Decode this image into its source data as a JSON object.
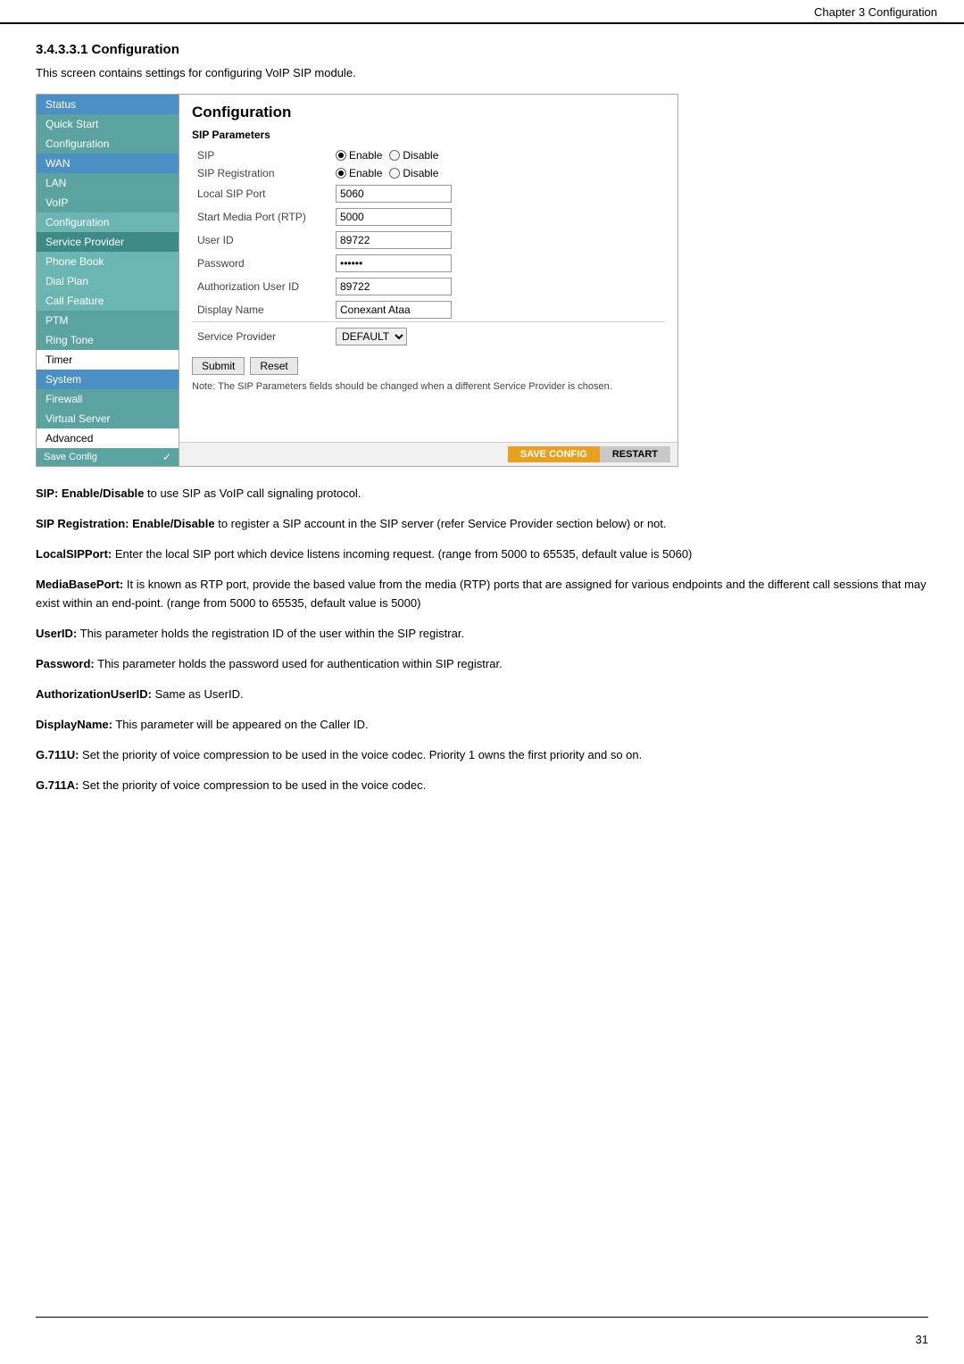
{
  "header": {
    "title": "Chapter 3 Configuration"
  },
  "page_number": "31",
  "section_title": "3.4.3.3.1 Configuration",
  "intro_text": "This screen contains settings for configuring VoIP SIP module.",
  "sidebar": {
    "items": [
      {
        "label": "Status",
        "style": "blue"
      },
      {
        "label": "Quick Start",
        "style": "teal"
      },
      {
        "label": "Configuration",
        "style": "active"
      },
      {
        "label": "WAN",
        "style": "blue"
      },
      {
        "label": "LAN",
        "style": "teal"
      },
      {
        "label": "VoIP",
        "style": "teal"
      },
      {
        "label": "Configuration",
        "style": "light-teal"
      },
      {
        "label": "Service Provider",
        "style": "dark-teal"
      },
      {
        "label": "Phone Book",
        "style": "light-teal"
      },
      {
        "label": "Dial Plan",
        "style": "light-teal"
      },
      {
        "label": "Call Feature",
        "style": "light-teal"
      },
      {
        "label": "PTM",
        "style": "teal"
      },
      {
        "label": "Ring Tone",
        "style": "teal"
      },
      {
        "label": "Timer",
        "style": "plain"
      },
      {
        "label": "System",
        "style": "blue"
      },
      {
        "label": "Firewall",
        "style": "teal"
      },
      {
        "label": "Virtual Server",
        "style": "teal"
      },
      {
        "label": "Advanced",
        "style": "plain"
      },
      {
        "label": "Save Config",
        "style": "orange"
      }
    ],
    "save_config_label": "SAVE CONFIG",
    "restart_label": "RESTART"
  },
  "config_panel": {
    "title": "Configuration",
    "section_label": "SIP Parameters",
    "fields": [
      {
        "label": "SIP",
        "type": "radio",
        "value": "enable"
      },
      {
        "label": "SIP Registration",
        "type": "radio",
        "value": "enable"
      },
      {
        "label": "Local SIP Port",
        "type": "text",
        "value": "5060"
      },
      {
        "label": "Start Media Port (RTP)",
        "type": "text",
        "value": "5000"
      },
      {
        "label": "User ID",
        "type": "text",
        "value": "89722"
      },
      {
        "label": "Password",
        "type": "password",
        "value": "••••••"
      },
      {
        "label": "Authorization User ID",
        "type": "text",
        "value": "89722"
      },
      {
        "label": "Display Name",
        "type": "text",
        "value": "Conexant Ataa"
      }
    ],
    "service_provider_label": "Service Provider",
    "service_provider_value": "DEFAULT",
    "submit_label": "Submit",
    "reset_label": "Reset",
    "note": "Note: The SIP Parameters fields should be changed when a different Service Provider is chosen."
  },
  "descriptions": [
    {
      "bold_part": "SIP: Enable/Disable",
      "text": " to use SIP as VoIP call signaling protocol."
    },
    {
      "bold_part": "SIP Registration: Enable/Disable",
      "text": " to register a SIP account in the SIP server (refer Service Provider section below) or not."
    },
    {
      "bold_part": "LocalSIPPort:",
      "text": " Enter the local SIP port which device listens incoming request. (range from 5000 to 65535, default value is 5060)"
    },
    {
      "bold_part": "MediaBasePort:",
      "text": " It is known as RTP port, provide the based value from the media (RTP) ports that are assigned for various endpoints and the different call sessions that may exist within an end-point. (range from 5000 to 65535, default value is 5000)"
    },
    {
      "bold_part": "UserID:",
      "text": " This parameter holds the registration ID of the user within the SIP registrar."
    },
    {
      "bold_part": "Password:",
      "text": " This parameter holds the password used for authentication within SIP registrar."
    },
    {
      "bold_part": "AuthorizationUserID:",
      "text": " Same as UserID."
    },
    {
      "bold_part": "DisplayName:",
      "text": " This parameter will be appeared on the Caller ID."
    },
    {
      "bold_part": "G.711U:",
      "text": " Set the priority of voice compression to be used in the voice codec. Priority 1 owns the first priority and so on."
    },
    {
      "bold_part": "G.711A:",
      "text": " Set the priority of voice compression to be used in the voice codec."
    }
  ]
}
